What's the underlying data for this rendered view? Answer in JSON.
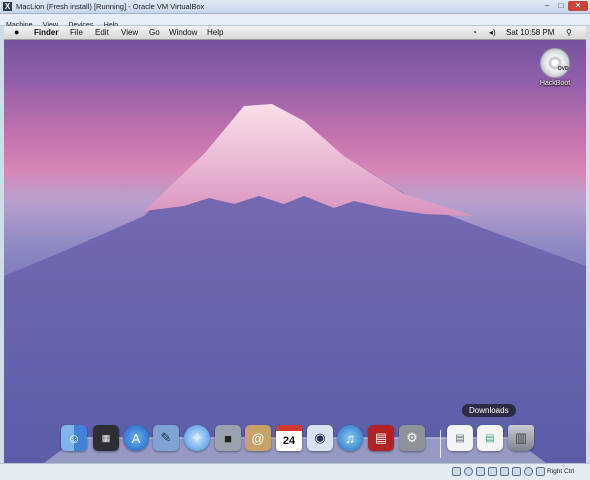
{
  "window": {
    "title": "MacLion (Fresh install) [Running] - Oracle VM VirtualBox",
    "controls": {
      "minimize": "–",
      "maximize": "□",
      "close": "✕"
    }
  },
  "host_menu": [
    "Machine",
    "View",
    "Devices",
    "Help"
  ],
  "mac_menubar": {
    "apple_icon": "apple-icon",
    "items": [
      "Finder",
      "File",
      "Edit",
      "View",
      "Go",
      "Window",
      "Help"
    ],
    "clock": "Sat 10:58 PM"
  },
  "desktop": {
    "icon_label": "HackBoot",
    "disc_text": "DVD"
  },
  "dock": {
    "tooltip": "Downloads",
    "calendar_day": "24",
    "icons": [
      "finder-icon",
      "dashboard-icon",
      "app-store-icon",
      "preview-icon",
      "safari-icon",
      "facetime-icon",
      "address-book-icon",
      "ical-icon",
      "photo-booth-icon",
      "itunes-icon",
      "photo-booth-film-icon",
      "system-preferences-icon",
      "documents-stack-icon",
      "downloads-stack-icon",
      "trash-icon"
    ]
  },
  "statusbar": {
    "host_key": "Right Ctrl"
  },
  "colors": {
    "sky_top": "#6e4f98",
    "sky_glow": "#d786b7",
    "mountain": "#5b5fa8",
    "snow": "#f0c2d6"
  }
}
